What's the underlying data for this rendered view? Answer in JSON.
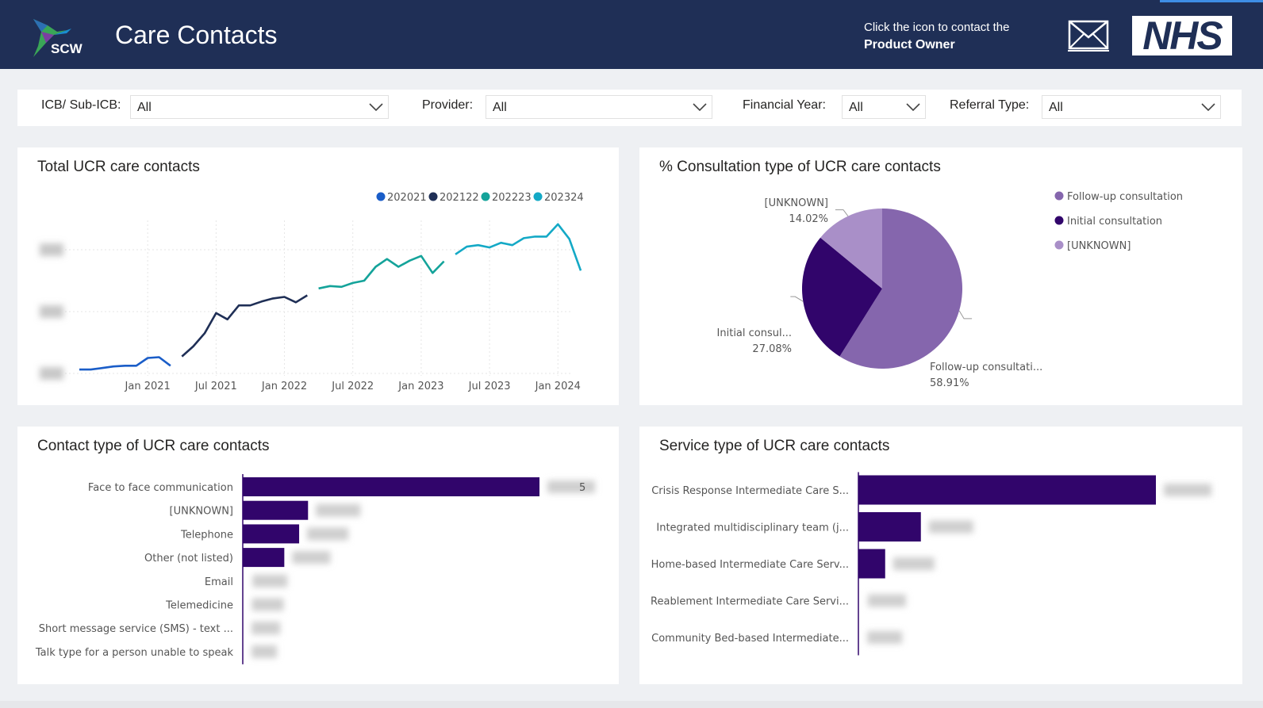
{
  "header": {
    "logo_text": "SCW",
    "title": "Care Contacts",
    "contact_line1": "Click the icon to contact the",
    "contact_line2": "Product Owner",
    "nhs_logo": "NHS",
    "icons": [
      "hummingbird-logo-icon",
      "mail-icon"
    ]
  },
  "filters": [
    {
      "label": "ICB/ Sub-ICB:",
      "value": "All"
    },
    {
      "label": "Provider:",
      "value": "All"
    },
    {
      "label": "Financial Year:",
      "value": "All"
    },
    {
      "label": "Referral Type:",
      "value": "All"
    }
  ],
  "colors": {
    "header_bg": "#1f2f56",
    "fy2021": "#1a5dc8",
    "fy2122": "#1f2f56",
    "fy2223": "#14a39a",
    "fy2324": "#14a9c6",
    "followup": "#8566ad",
    "initial": "#31056b",
    "unknown": "#a98fc8",
    "bar": "#31056b"
  },
  "chart_data": [
    {
      "type": "line",
      "title": "Total UCR care contacts",
      "x_ticks": [
        "Jan 2021",
        "Jul 2021",
        "Jan 2022",
        "Jul 2022",
        "Jan 2023",
        "Jul 2023",
        "Jan 2024"
      ],
      "y_note": "y-axis values obscured",
      "legend_position": "top-right",
      "grid": true,
      "series": [
        {
          "name": "202021",
          "color": "#1a5dc8",
          "x": [
            "2020-07",
            "2020-08",
            "2020-09",
            "2020-10",
            "2020-11",
            "2020-12",
            "2021-01",
            "2021-02",
            "2021-03"
          ],
          "y": [
            0.05,
            0.05,
            0.07,
            0.09,
            0.1,
            0.1,
            0.2,
            0.21,
            0.1
          ]
        },
        {
          "name": "202122",
          "color": "#1f2f56",
          "x": [
            "2021-04",
            "2021-05",
            "2021-06",
            "2021-07",
            "2021-08",
            "2021-09",
            "2021-10",
            "2021-11",
            "2021-12",
            "2022-01",
            "2022-02",
            "2022-03"
          ],
          "y": [
            0.22,
            0.35,
            0.52,
            0.78,
            0.7,
            0.88,
            0.88,
            0.93,
            0.97,
            0.99,
            0.92,
            1.01
          ]
        },
        {
          "name": "202223",
          "color": "#14a39a",
          "x": [
            "2022-04",
            "2022-05",
            "2022-06",
            "2022-07",
            "2022-08",
            "2022-09",
            "2022-10",
            "2022-11",
            "2022-12",
            "2023-01",
            "2023-02",
            "2023-03"
          ],
          "y": [
            1.1,
            1.13,
            1.12,
            1.17,
            1.2,
            1.38,
            1.48,
            1.38,
            1.46,
            1.52,
            1.3,
            1.45
          ]
        },
        {
          "name": "202324",
          "color": "#14a9c6",
          "x": [
            "2023-04",
            "2023-05",
            "2023-06",
            "2023-07",
            "2023-08",
            "2023-09",
            "2023-10",
            "2023-11",
            "2023-12",
            "2024-01",
            "2024-02",
            "2024-03"
          ],
          "y": [
            1.54,
            1.64,
            1.66,
            1.63,
            1.69,
            1.66,
            1.75,
            1.77,
            1.77,
            1.93,
            1.74,
            1.33
          ]
        }
      ]
    },
    {
      "type": "pie",
      "title": "% Consultation type of UCR care contacts",
      "legend_position": "top-right",
      "slices": [
        {
          "name": "Follow-up consultation",
          "label": "Follow-up consultati...",
          "value": 58.91,
          "pct": "58.91%",
          "color": "#8566ad"
        },
        {
          "name": "Initial consultation",
          "label": "Initial consul...",
          "value": 27.08,
          "pct": "27.08%",
          "color": "#31056b"
        },
        {
          "name": "[UNKNOWN]",
          "label": "[UNKNOWN]",
          "value": 14.02,
          "pct": "14.02%",
          "color": "#a98fc8"
        }
      ]
    },
    {
      "type": "bar",
      "orientation": "horizontal",
      "title": "Contact type of UCR care contacts",
      "categories": [
        "Face to face communication",
        "[UNKNOWN]",
        "Telephone",
        "Other (not listed)",
        "Email",
        "Telemedicine",
        "Short message service (SMS) - text ...",
        "Talk type for a person unable to speak"
      ],
      "values": [
        1.0,
        0.22,
        0.19,
        0.14,
        0.006,
        0.004,
        0.003,
        0.002
      ],
      "value_note": "data labels obscured",
      "visible_label_fragment": "5"
    },
    {
      "type": "bar",
      "orientation": "horizontal",
      "title": "Service type of UCR care contacts",
      "categories": [
        "Crisis Response Intermediate Care S...",
        "Integrated multidisciplinary team (j...",
        "Home-based Intermediate Care Serv...",
        "Reablement Intermediate Care Servi...",
        "Community Bed-based Intermediate..."
      ],
      "values": [
        1.0,
        0.21,
        0.09,
        0.005,
        0.003
      ],
      "value_note": "data labels obscured"
    }
  ]
}
